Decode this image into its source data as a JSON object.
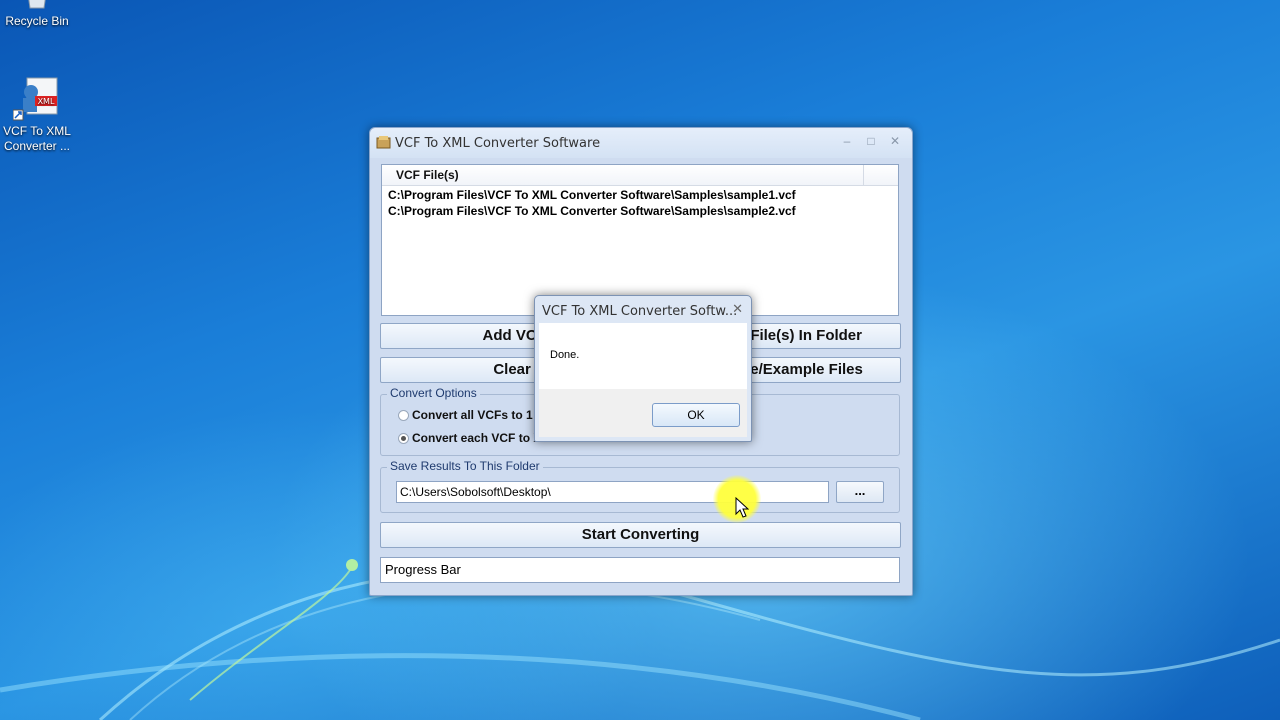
{
  "desktop": {
    "icons": [
      {
        "label": "Recycle Bin"
      },
      {
        "label_line1": "VCF To XML",
        "label_line2": "Converter ..."
      }
    ]
  },
  "window": {
    "title": "VCF To XML Converter Software",
    "file_list": {
      "column_header": "VCF File(s)",
      "rows": [
        "C:\\Program Files\\VCF To XML Converter Software\\Samples\\sample1.vcf",
        "C:\\Program Files\\VCF To XML Converter Software\\Samples\\sample2.vcf"
      ]
    },
    "buttons": {
      "add_files": "Add VCF Fil",
      "add_folder": "F File(s) In Folder",
      "clear_list": "Clear Lis",
      "samples": "le/Example Files",
      "start": "Start Converting",
      "browse": "..."
    },
    "convert_options": {
      "legend": "Convert Options",
      "options": [
        {
          "label": "Convert all VCFs to 1 X",
          "selected": false
        },
        {
          "label": "Convert each VCF to X",
          "selected": true
        }
      ]
    },
    "save_results": {
      "legend": "Save Results To This Folder",
      "path": "C:\\Users\\Sobolsoft\\Desktop\\"
    },
    "progress_label": "Progress Bar"
  },
  "dialog": {
    "title": "VCF To XML Converter Softw...",
    "message": "Done.",
    "ok_label": "OK"
  }
}
